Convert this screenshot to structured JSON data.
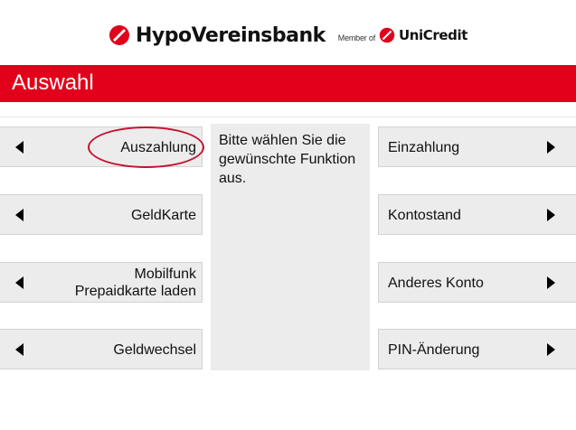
{
  "logo": {
    "brand_name": "HypoVereinsbank",
    "member_text": "Member of",
    "partner_name": "UniCredit",
    "brand_color": "#e2001a"
  },
  "title": "Auswahl",
  "left_buttons": [
    {
      "label": "Auszahlung",
      "icon": "arrow-left-icon"
    },
    {
      "label": "GeldKarte",
      "icon": "arrow-left-icon"
    },
    {
      "label_line1": "Mobilfunk",
      "label_line2": "Prepaidkarte laden",
      "icon": "arrow-left-icon"
    },
    {
      "label": "Geldwechsel",
      "icon": "arrow-left-icon"
    }
  ],
  "right_buttons": [
    {
      "label": "Einzahlung",
      "icon": "arrow-right-icon"
    },
    {
      "label": "Kontostand",
      "icon": "arrow-right-icon"
    },
    {
      "label": "Anderes Konto",
      "icon": "arrow-right-icon"
    },
    {
      "label": "PIN-Änderung",
      "icon": "arrow-right-icon"
    }
  ],
  "instruction": "Bitte wählen Sie die gewünschte Funktion aus.",
  "highlight_color": "#c41230"
}
